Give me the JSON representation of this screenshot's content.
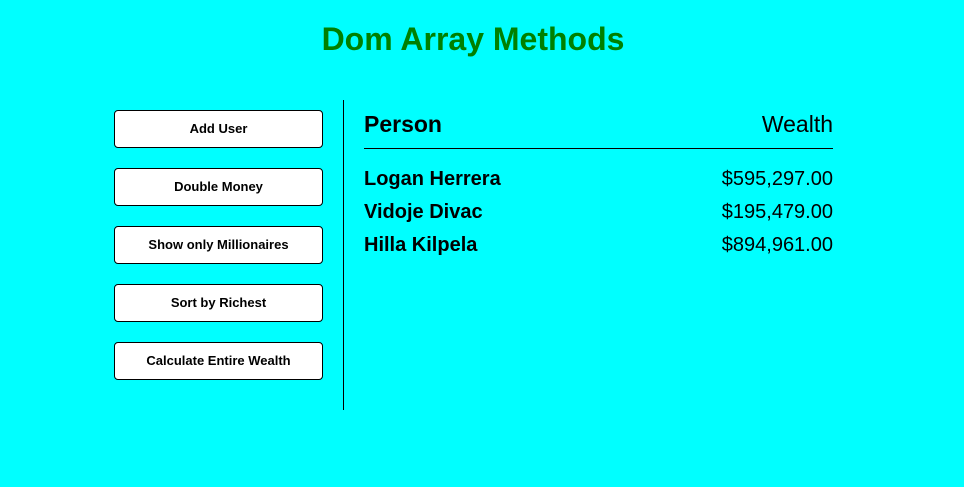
{
  "header": {
    "title": "Dom Array Methods"
  },
  "controls": {
    "add_user": "Add User",
    "double_money": "Double Money",
    "show_millionaires": "Show only Millionaires",
    "sort_richest": "Sort by Richest",
    "calculate_wealth": "Calculate Entire Wealth"
  },
  "table": {
    "person_heading": "Person",
    "wealth_heading": "Wealth",
    "rows": [
      {
        "name": "Logan Herrera",
        "wealth": "$595,297.00"
      },
      {
        "name": "Vidoje Divac",
        "wealth": "$195,479.00"
      },
      {
        "name": "Hilla Kilpela",
        "wealth": "$894,961.00"
      }
    ]
  },
  "colors": {
    "background": "#00ffff",
    "title": "#008000"
  }
}
